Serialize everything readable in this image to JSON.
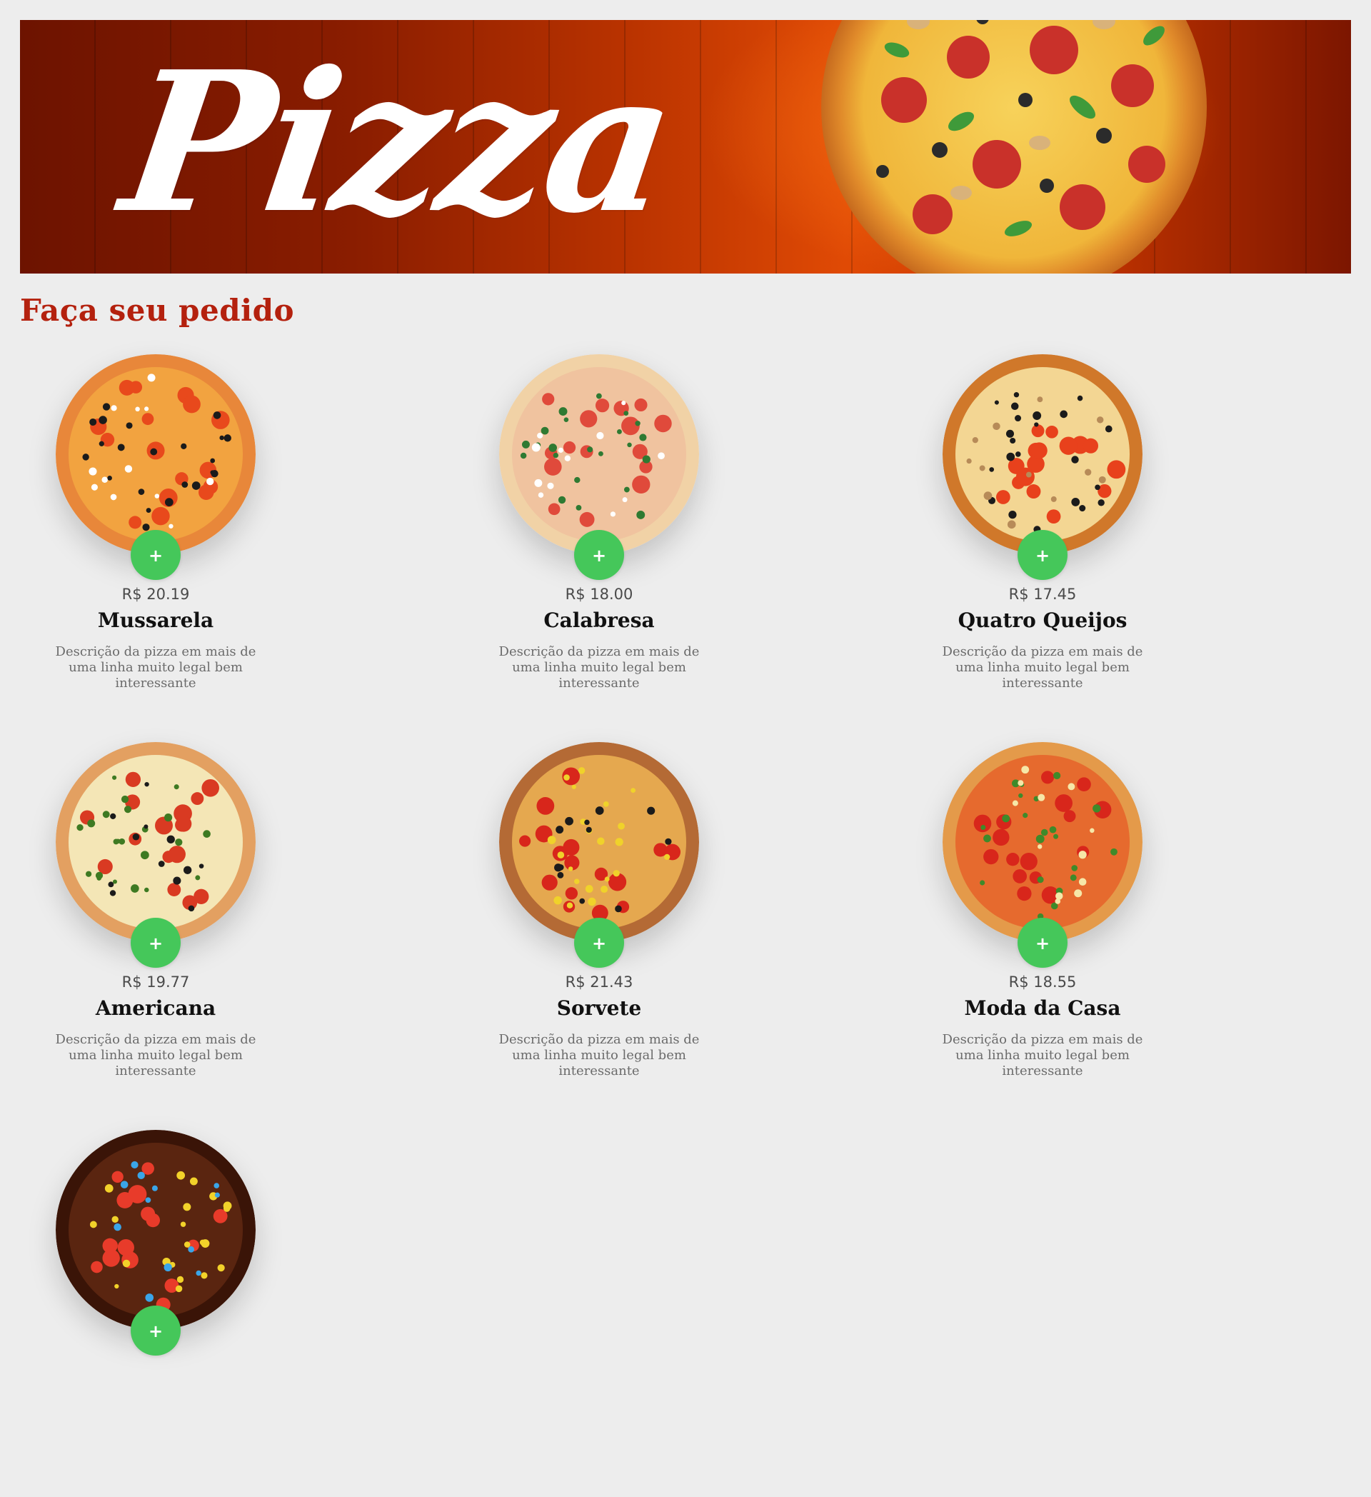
{
  "banner": {
    "title": "Pizza"
  },
  "section_title": "Faça seu pedido",
  "add_label": "+",
  "pizzas": [
    {
      "name": "Mussarela",
      "price": "R$ 20.19",
      "description": "Descrição da pizza em mais de uma linha muito legal bem interessante",
      "crust": "#e8873a",
      "cheese": "#f2a340",
      "topping1": "#e8491c",
      "topping2": "#1b1b1b",
      "topping3": "#ffffff"
    },
    {
      "name": "Calabresa",
      "price": "R$ 18.00",
      "description": "Descrição da pizza em mais de uma linha muito legal bem interessante",
      "crust": "#f1d2a6",
      "cheese": "#f0c39f",
      "topping1": "#e04a3b",
      "topping2": "#2f7a32",
      "topping3": "#ffffff"
    },
    {
      "name": "Quatro Queijos",
      "price": "R$ 17.45",
      "description": "Descrição da pizza em mais de uma linha muito legal bem interessante",
      "crust": "#d0782a",
      "cheese": "#f3d693",
      "topping1": "#e8411c",
      "topping2": "#1b1b1b",
      "topping3": "#b78b58"
    },
    {
      "name": "Americana",
      "price": "R$ 19.77",
      "description": "Descrição da pizza em mais de uma linha muito legal bem interessante",
      "crust": "#e3a061",
      "cheese": "#f4e6b6",
      "topping1": "#d93a22",
      "topping2": "#3e7a22",
      "topping3": "#1b1b1b"
    },
    {
      "name": "Sorvete",
      "price": "R$ 21.43",
      "description": "Descrição da pizza em mais de uma linha muito legal bem interessante",
      "crust": "#b46a35",
      "cheese": "#e5a84f",
      "topping1": "#d8261b",
      "topping2": "#f0d22a",
      "topping3": "#1b1b1b"
    },
    {
      "name": "Moda da Casa",
      "price": "R$ 18.55",
      "description": "Descrição da pizza em mais de uma linha muito legal bem interessante",
      "crust": "#e49a4a",
      "cheese": "#e66a2e",
      "topping1": "#d8261b",
      "topping2": "#3f8a2a",
      "topping3": "#f6e7a8"
    },
    {
      "name": "",
      "price": "",
      "description": "",
      "crust": "#3a1407",
      "cheese": "#5a2510",
      "topping1": "#e83b2a",
      "topping2": "#f2d22a",
      "topping3": "#3aa5e8"
    }
  ]
}
